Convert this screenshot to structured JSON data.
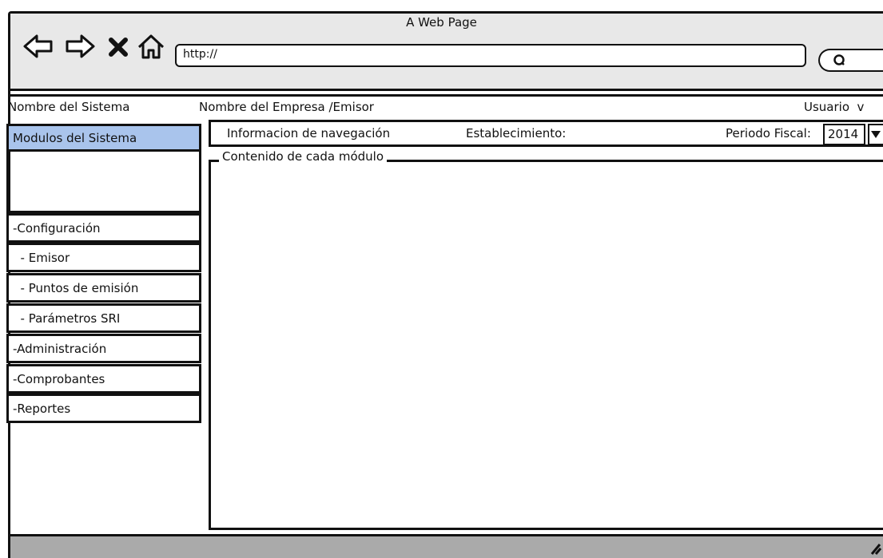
{
  "window": {
    "title": "A Web Page"
  },
  "browser": {
    "url": "http://",
    "icons": [
      "back-arrow-icon",
      "forward-arrow-icon",
      "close-x-icon",
      "home-icon",
      "search-icon"
    ]
  },
  "header": {
    "system_name": "Nombre del Sistema",
    "company": "Nombre del Empresa /Emisor",
    "user": "Usuario  v"
  },
  "sidebar": {
    "title": "Modulos del Sistema",
    "items": [
      {
        "label": "-Configuración"
      },
      {
        "label": "  - Emisor"
      },
      {
        "label": "  - Puntos de emisión"
      },
      {
        "label": "  - Parámetros SRI"
      },
      {
        "label": "-Administración"
      },
      {
        "label": "-Comprobantes"
      },
      {
        "label": "-Reportes"
      }
    ]
  },
  "navbar": {
    "info": "Informacion de navegación",
    "establishment": "Establecimiento:",
    "fiscal_label": "Periodo Fiscal:",
    "fiscal_value": "2014"
  },
  "content": {
    "label": "Contenido de cada módulo"
  },
  "colors": {
    "active_sidebar": "#a9c4ec",
    "chrome": "#e8e8e8",
    "statusbar": "#aaaaaa"
  }
}
